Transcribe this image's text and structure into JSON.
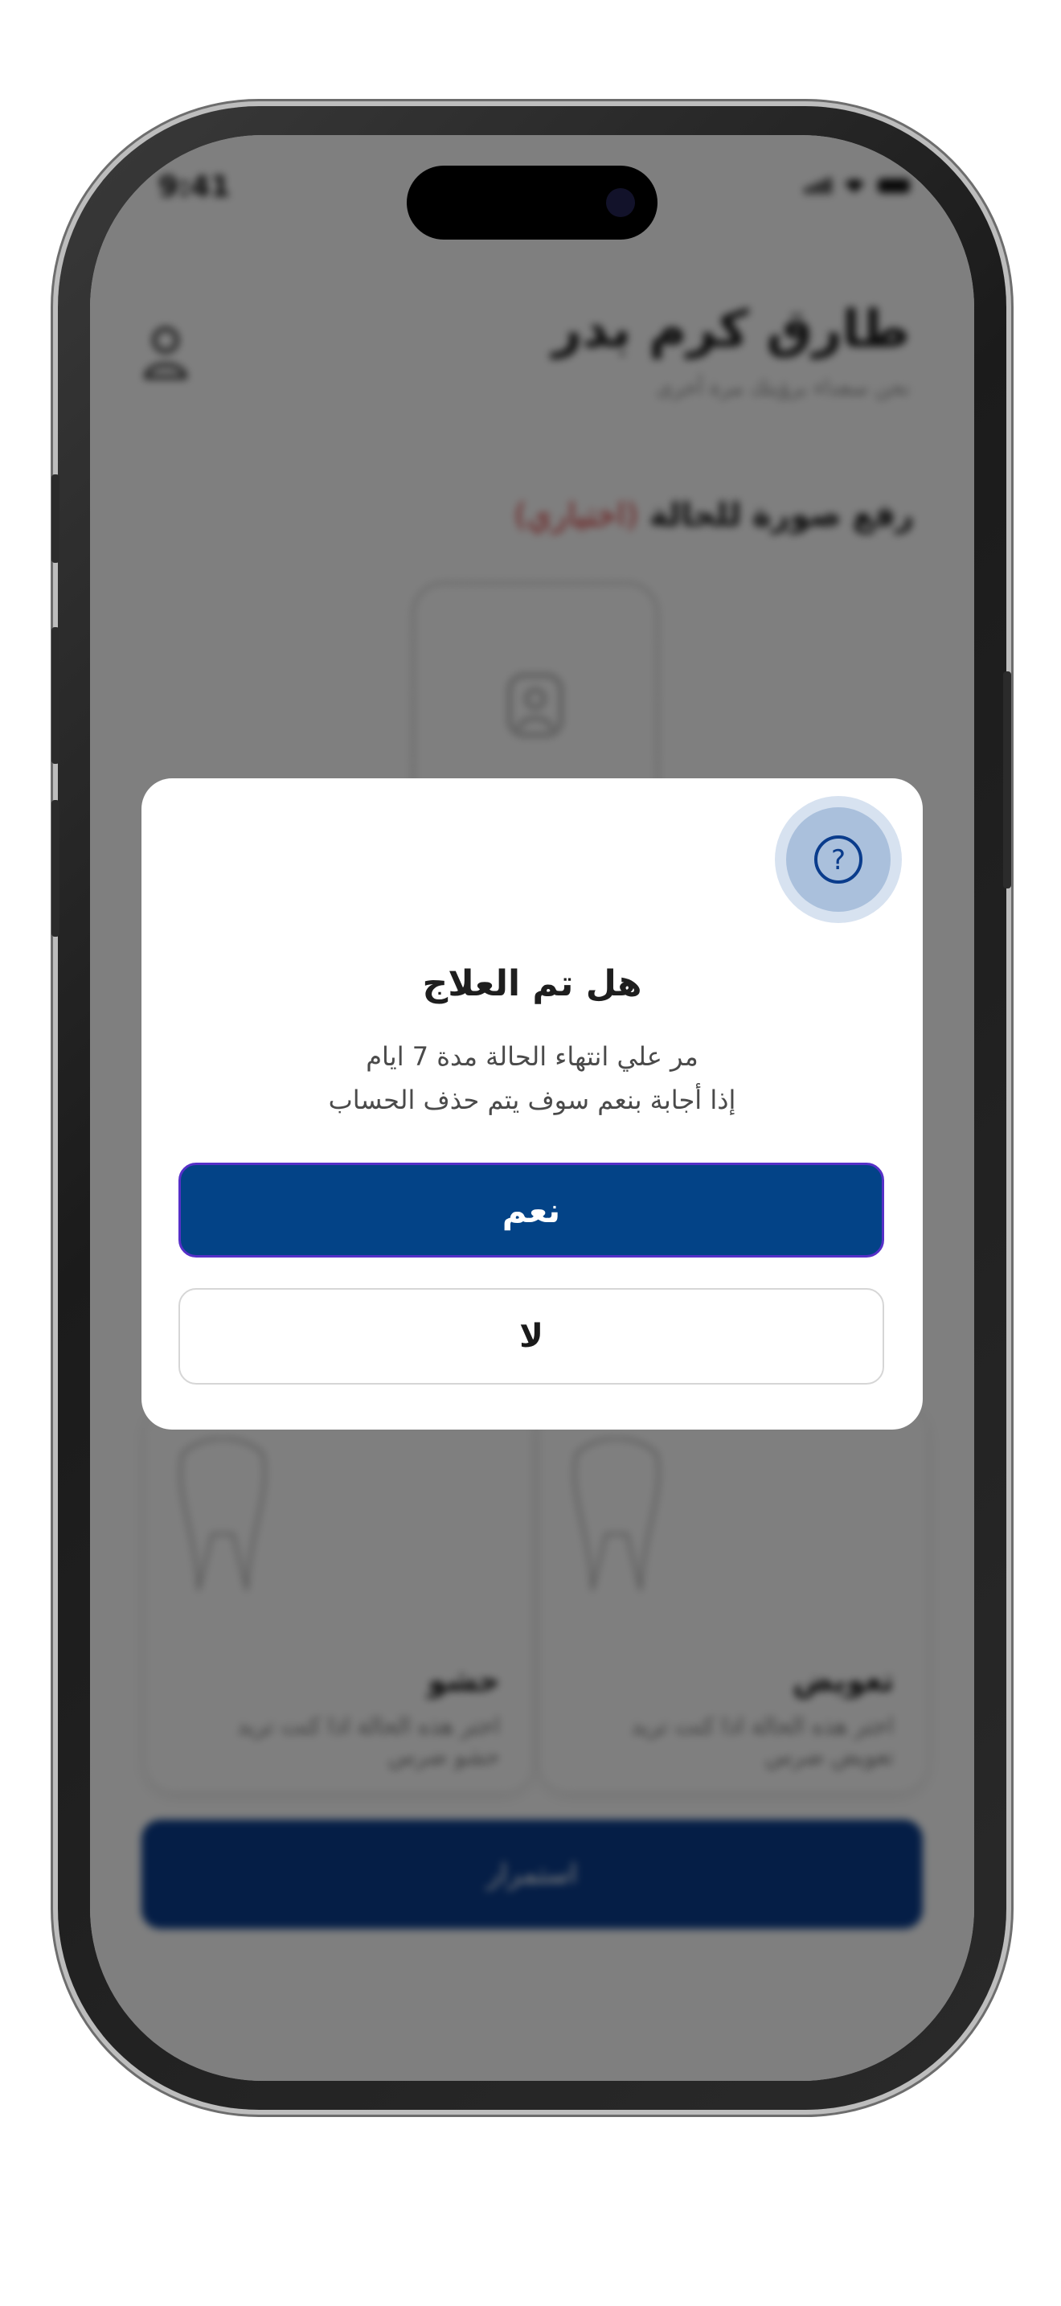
{
  "status_bar": {
    "time": "9:41"
  },
  "header": {
    "user_name": "طارق كرم بدر",
    "subtitle": "نحن سعداء برؤيتك مرة أخرى"
  },
  "upload": {
    "title": "رفع صورة للحالة",
    "optional": "(اختياري)"
  },
  "cards": [
    {
      "title": "تعويض",
      "description": "اختر هذه الحالة اذا كنت تريد تعويض ضرس"
    },
    {
      "title": "حشو",
      "description": "اختر هذه الحالة اذا كنت تريد حشو ضرس"
    }
  ],
  "continue_button": "استمرار",
  "dialog": {
    "icon": "question-mark-icon",
    "title": "هل تم العلاج",
    "message_line1": "مر علي انتهاء الحالة مدة 7 ايام",
    "message_line2": "إذا أجابة بنعم سوف يتم حذف الحساب",
    "yes_label": "نعم",
    "no_label": "لا"
  },
  "colors": {
    "primary": "#034387",
    "accent_border": "#5630c8",
    "icon_halo": "#aac0dc"
  }
}
